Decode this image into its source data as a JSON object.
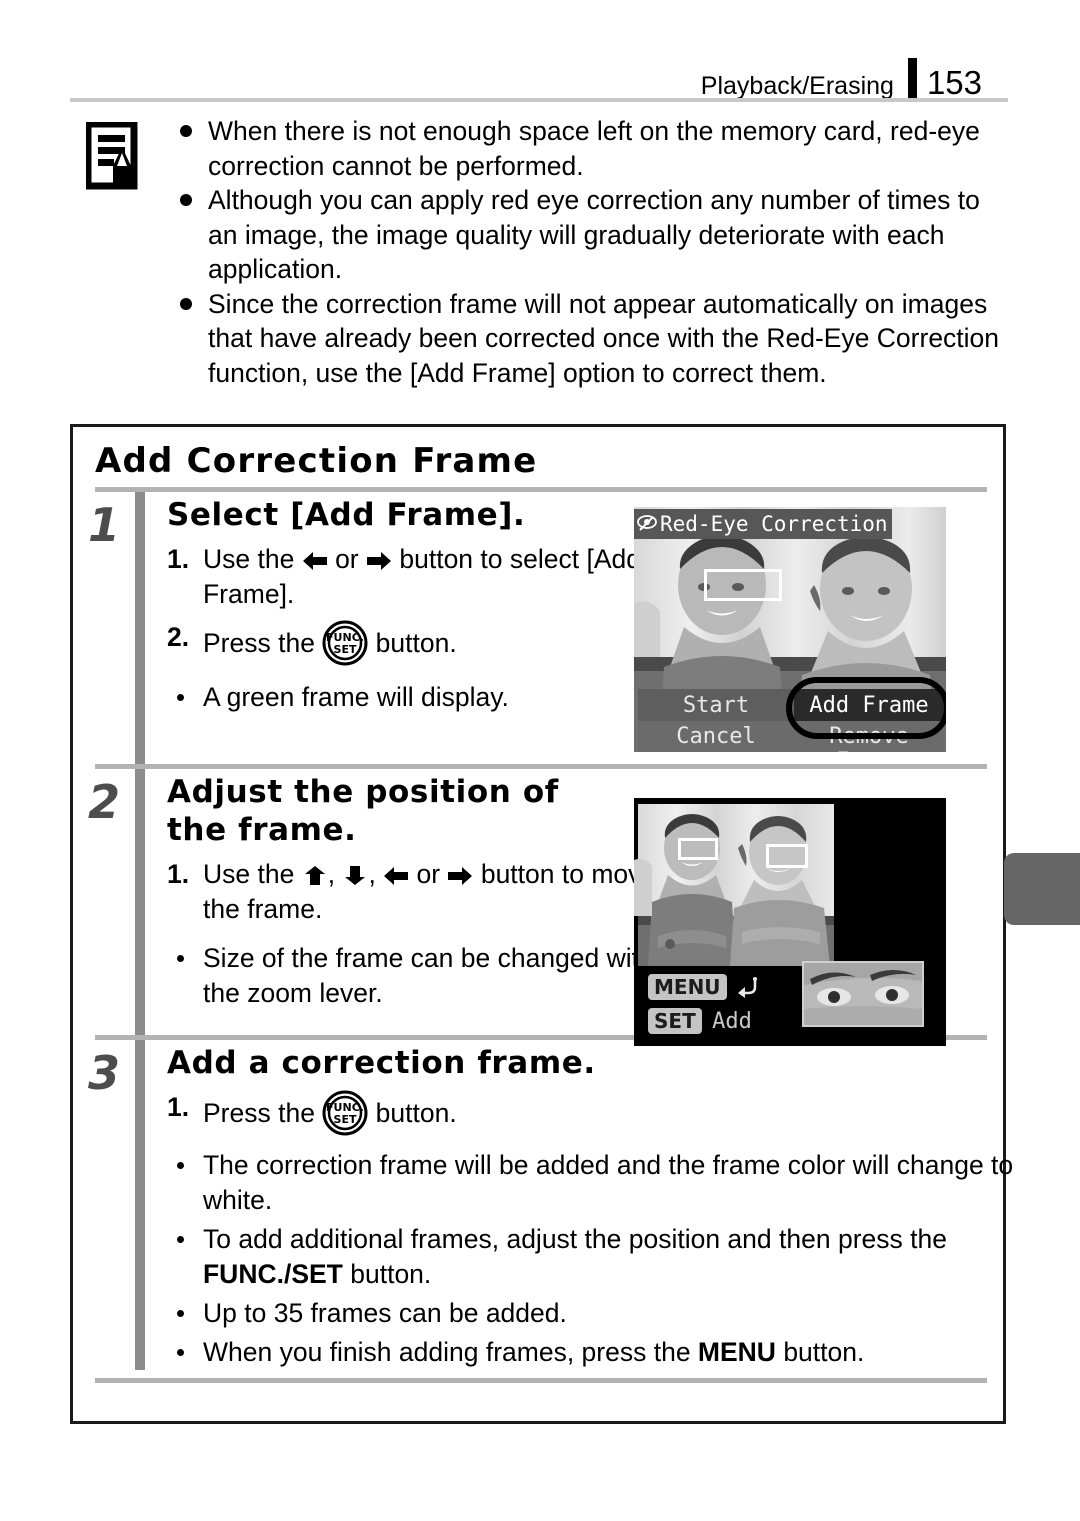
{
  "header": {
    "chapter": "Playback/Erasing",
    "page_number": "153"
  },
  "note": {
    "icon": "memo-note-icon",
    "items": [
      "When there is not enough space left on the memory card, red-eye correction cannot be performed.",
      "Although you can apply red eye correction any number of times to an image, the image quality will gradually deteriorate with each application.",
      "Since the correction frame will not appear automatically on images that have already been corrected once with the Red-Eye Correction function, use the [Add Frame] option to correct them."
    ]
  },
  "section": {
    "title": "Add Correction Frame",
    "steps": [
      {
        "number": "1",
        "heading": "Select [Add Frame].",
        "lines": [
          {
            "kind": "numbered",
            "index": "1.",
            "before": "Use the ",
            "mid": " or ",
            "after": " button to select [Add Frame].",
            "icons": [
              "left-arrow",
              "right-arrow"
            ]
          },
          {
            "kind": "numbered",
            "index": "2.",
            "before": "Press the ",
            "after": " button.",
            "icons": [
              "func-set-button"
            ]
          },
          {
            "kind": "bullet",
            "text": "A green frame will display."
          }
        ]
      },
      {
        "number": "2",
        "heading": "Adjust the position of the frame.",
        "lines": [
          {
            "kind": "numbered",
            "index": "1.",
            "before": "Use the ",
            "after": " button to move the frame.",
            "icons": [
              "up-arrow",
              "down-arrow",
              "left-arrow",
              "right-arrow"
            ]
          },
          {
            "kind": "bullet",
            "text": "Size of the frame can be changed with the zoom lever."
          }
        ]
      },
      {
        "number": "3",
        "heading": "Add a correction frame.",
        "lines": [
          {
            "kind": "numbered",
            "index": "1.",
            "before": "Press the ",
            "after": " button.",
            "icons": [
              "func-set-button"
            ]
          },
          {
            "kind": "bullet",
            "text": "The correction frame will be added and the frame color will change to white."
          },
          {
            "kind": "bullet",
            "rich": true,
            "part1": "To add additional frames, adjust the position and then press the ",
            "bold": "FUNC./SET",
            "part2": " button."
          },
          {
            "kind": "bullet",
            "text": "Up to 35 frames can be added."
          },
          {
            "kind": "bullet",
            "rich": true,
            "part1": "When you finish adding frames, press the ",
            "bold": "MENU",
            "part2": " button."
          }
        ]
      }
    ]
  },
  "lcd_screen_1": {
    "title": "Red-Eye Correction",
    "title_icon": "red-eye-icon",
    "options": {
      "start": "Start",
      "cancel": "Cancel",
      "add_frame": "Add Frame",
      "remove_frame": "Remove Frame"
    },
    "selected_option": "Add Frame",
    "callout": "oval-highlight"
  },
  "lcd_screen_2": {
    "menu_badge": "MENU",
    "menu_action_icon": "return-arrow-icon",
    "set_badge": "SET",
    "set_action": "Add",
    "inset": "magnified-eye-preview",
    "correction_frames": 2
  },
  "colors": {
    "rule_gray": "#c9c9c9",
    "step_number_gray": "#4d4d4d",
    "vertical_rule_gray": "#8c8c8c",
    "thumb_tab_gray": "#666666",
    "lcd_title_bar": "#575757",
    "box_border": "#1a1a1a"
  }
}
